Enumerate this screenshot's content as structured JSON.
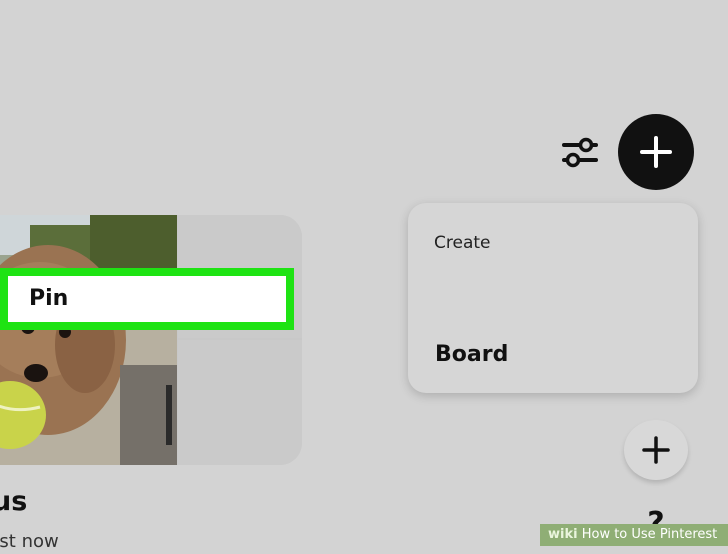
{
  "board": {
    "title": "us",
    "meta": "ust now"
  },
  "toolbar": {
    "filter_icon": "sliders-icon",
    "create_icon": "plus-icon"
  },
  "create_menu": {
    "header": "Create",
    "items": [
      {
        "label": "Pin",
        "highlighted": true
      },
      {
        "label": "Board",
        "highlighted": false
      }
    ],
    "highlight_color": "#1ee313"
  },
  "floating": {
    "plus_icon": "plus-icon",
    "help_label": "?"
  },
  "watermark": {
    "brand": "wiki",
    "text": "How to Use Pinterest"
  }
}
